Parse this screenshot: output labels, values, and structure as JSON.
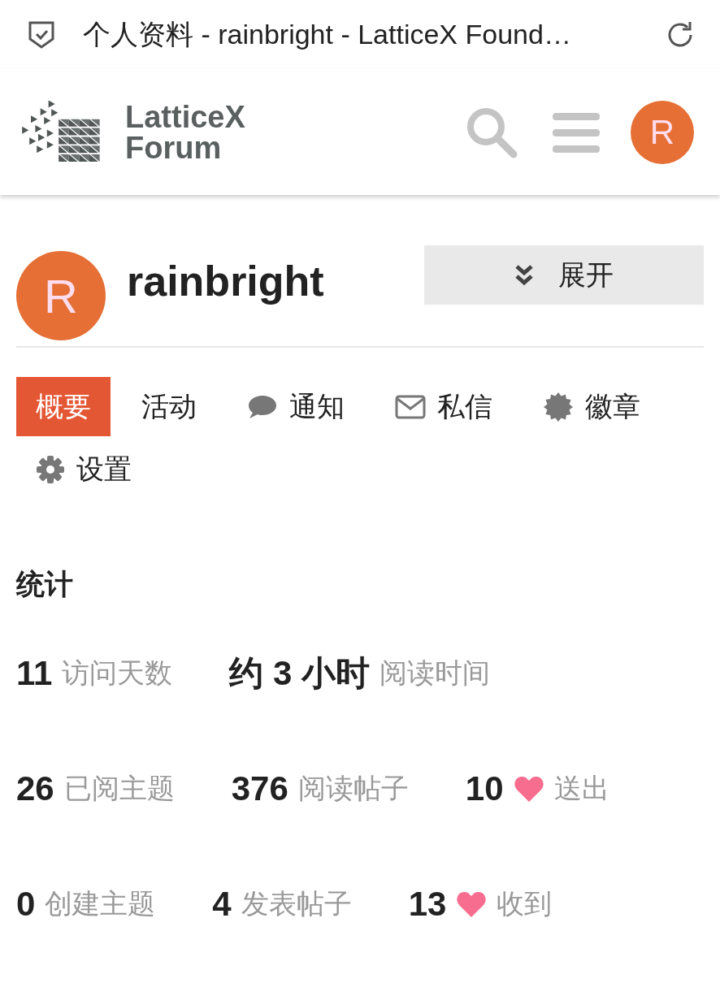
{
  "browser_bar": {
    "title": "个人资料 - rainbright - LatticeX Found…"
  },
  "header": {
    "logo_lines": [
      "LatticeX",
      "Forum"
    ],
    "avatar_letter": "R"
  },
  "profile": {
    "avatar_letter": "R",
    "username": "rainbright",
    "expand_button": "展开"
  },
  "nav_tabs": [
    {
      "label": "概要",
      "kind": "plain",
      "selected": true
    },
    {
      "label": "活动",
      "kind": "plain",
      "selected": false
    },
    {
      "label": "通知",
      "kind": "chat",
      "selected": false
    },
    {
      "label": "私信",
      "kind": "mail",
      "selected": false
    },
    {
      "label": "徽章",
      "kind": "badge",
      "selected": false
    },
    {
      "label": "设置",
      "kind": "gear",
      "selected": false
    }
  ],
  "stats": {
    "title": "统计",
    "rows": [
      {
        "items": [
          {
            "value": "11",
            "label": "访问天数"
          },
          {
            "value": "约 3 小时",
            "label": "阅读时间"
          }
        ]
      },
      {
        "items": [
          {
            "value": "26",
            "label": "已阅主题"
          },
          {
            "value": "376",
            "label": "阅读帖子"
          },
          {
            "value": "10",
            "label": "送出",
            "heart": true
          }
        ]
      },
      {
        "items": [
          {
            "value": "0",
            "label": "创建主题"
          },
          {
            "value": "4",
            "label": "发表帖子"
          },
          {
            "value": "13",
            "label": "收到",
            "heart": true
          }
        ]
      }
    ]
  }
}
